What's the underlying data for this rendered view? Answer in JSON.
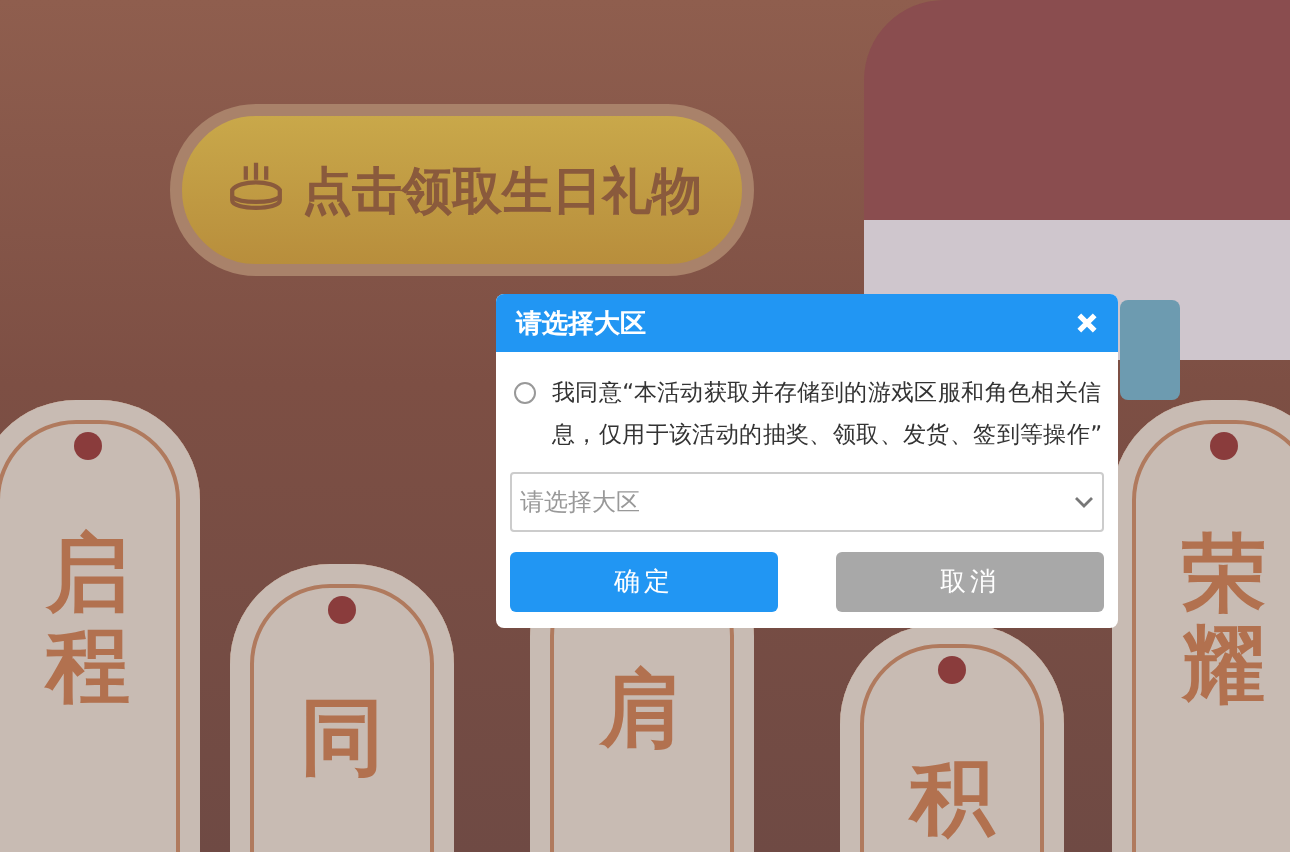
{
  "banner": {
    "label": "点击领取生日礼物"
  },
  "tags": [
    {
      "text": "启程"
    },
    {
      "text": "同"
    },
    {
      "text": "肩"
    },
    {
      "text": "积"
    },
    {
      "text": "荣耀"
    }
  ],
  "dialog": {
    "title": "请选择大区",
    "agreement": {
      "checked": false,
      "text": "我同意“本活动获取并存储到的游戏区服和角色相关信息，仅用于该活动的抽奖、领取、发货、签到等操作”"
    },
    "select": {
      "placeholder": "请选择大区"
    },
    "buttons": [
      {
        "label": "确定",
        "kind": "primary"
      },
      {
        "label": "取消",
        "kind": "secondary"
      }
    ]
  }
}
